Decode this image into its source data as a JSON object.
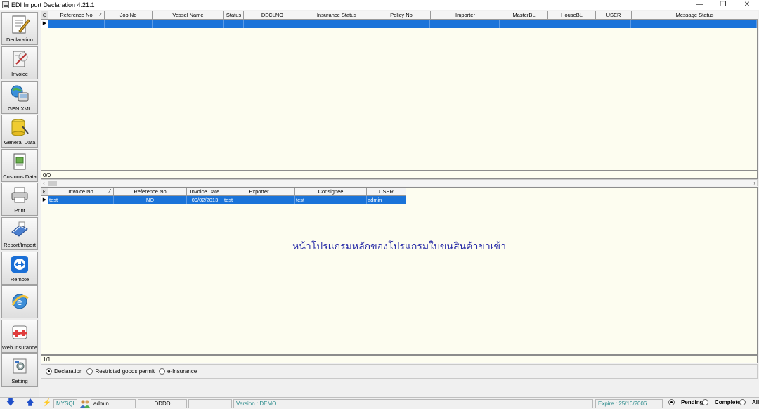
{
  "window": {
    "title": "EDI Import Declaration 4.21.1",
    "controls": [
      "—",
      "❐",
      "✕"
    ]
  },
  "sidebar": {
    "items": [
      {
        "label": "Declaration",
        "icon": "declaration-icon"
      },
      {
        "label": "Invoice",
        "icon": "invoice-icon"
      },
      {
        "label": "GEN XML",
        "icon": "gen-xml-icon"
      },
      {
        "label": "General Data",
        "icon": "general-data-icon"
      },
      {
        "label": "Customs Data",
        "icon": "customs-data-icon"
      },
      {
        "label": "Print",
        "icon": "printer-icon"
      },
      {
        "label": "Report/Import",
        "icon": "report-import-icon"
      },
      {
        "label": "Remote",
        "icon": "remote-icon"
      },
      {
        "label": "",
        "icon": "browser-icon"
      },
      {
        "label": "Web Insurance",
        "icon": "web-insurance-icon"
      },
      {
        "label": "Setting",
        "icon": "setting-icon"
      }
    ]
  },
  "declaration_grid": {
    "columns": [
      "Reference No",
      "Job No",
      "Vessel Name",
      "Status",
      "DECLNO",
      "Insurance Status",
      "Policy No",
      "Importer",
      "MasterBL",
      "HouseBL",
      "USER",
      "Message Status"
    ],
    "sorted_column": "Reference No",
    "rows": [
      [
        "",
        "",
        "",
        "",
        "",
        "",
        "",
        "",
        "",
        "",
        "",
        ""
      ]
    ],
    "record_count": "0/0"
  },
  "invoice_grid": {
    "columns": [
      "Invoice No",
      "Reference No",
      "Invoice Date",
      "Exporter",
      "Consignee",
      "USER"
    ],
    "sorted_column": "Invoice No",
    "rows": [
      [
        "test",
        "NO",
        "09/02/2013",
        "test",
        "test",
        "admin"
      ]
    ],
    "record_count": "1/1"
  },
  "main_message": "หน้าโปรแกรมหลักของโปรแกรมใบขนสินค้าขาเข้า",
  "doc_type": {
    "options": [
      "Declaration",
      "Restricted goods permit",
      "e-Insurance"
    ],
    "selected": "Declaration"
  },
  "statusbar": {
    "db": "MYSQL",
    "user": "admin",
    "code": "DDDD",
    "version": "Version : DEMO",
    "expire": "Expire : 25/10/2006",
    "filters": [
      "Pending",
      "Complete",
      "All"
    ],
    "selected_filter": "Pending"
  },
  "colors": {
    "selection": "#1a73d9",
    "grid_bg": "#fdfdf0",
    "message": "#2b2fa8",
    "status_teal": "#2a8a8a"
  }
}
